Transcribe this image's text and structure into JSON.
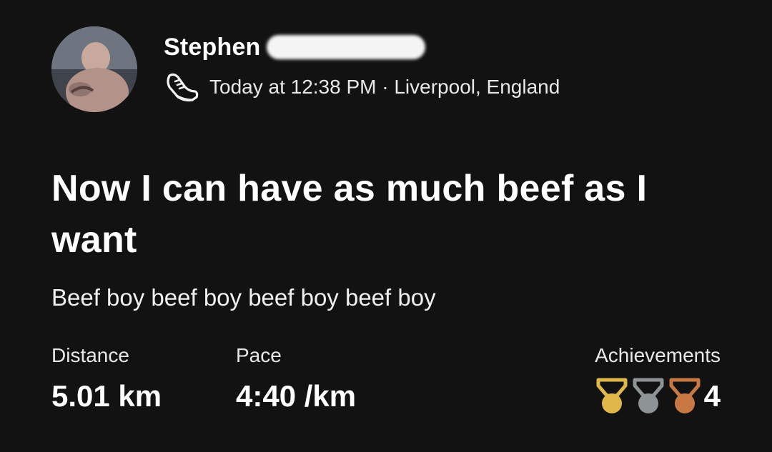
{
  "athlete": {
    "name": "Stephen"
  },
  "activity": {
    "meta": "Today at 12:38 PM · Liverpool, England",
    "type_icon": "running-shoe-icon",
    "title": "Now I can have as much beef as I want",
    "description": "Beef boy beef boy beef boy beef boy"
  },
  "stats": {
    "distance": {
      "label": "Distance",
      "value": "5.01 km"
    },
    "pace": {
      "label": "Pace",
      "value": "4:40 /km"
    },
    "achievements": {
      "label": "Achievements",
      "count": "4",
      "medals": [
        {
          "icon": "gold-medal-icon",
          "color": "#e0b84a"
        },
        {
          "icon": "silver-medal-icon",
          "color": "#8e9396"
        },
        {
          "icon": "bronze-medal-icon",
          "color": "#c77843"
        }
      ]
    }
  },
  "colors": {
    "background": "#121212",
    "text": "#ffffff"
  }
}
